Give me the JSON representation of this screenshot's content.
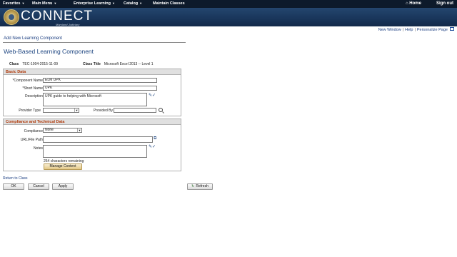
{
  "topnav": {
    "menus": [
      "Favorites",
      "Main Menu",
      "Enterprise Learning",
      "Catalog",
      "Maintain Classes"
    ],
    "home": "Home",
    "signout": "Sign out"
  },
  "banner": {
    "logo": "CONNECT",
    "logo_sub": "Maryland Judiciary"
  },
  "links": {
    "new_window": "New Window",
    "help": "Help",
    "personalize": "Personalize Page"
  },
  "breadcrumb": "Add New Learning Component",
  "page_title": "Web-Based Learning Component",
  "class_info": {
    "class_label": "Class",
    "class_value": "TEC-1004-2015-11-09",
    "title_label": "Class Title",
    "title_value": "Microsoft Excel 2013 -- Level 1"
  },
  "basic": {
    "header": "Basic Data",
    "component_name_label": "*Component Name",
    "component_name": "ELM UPK",
    "short_name_label": "*Short Name",
    "short_name": "UPK",
    "description_label": "Description",
    "description": "UPK guide to helping with Microsoft",
    "provider_type_label": "Provider Type",
    "provider_type": "",
    "provided_by_label": "Provided By",
    "provided_by": ""
  },
  "compliance": {
    "header": "Compliance and Technical Data",
    "compliance_label": "Compliance",
    "compliance_value": "None",
    "url_label": "URL/File Path",
    "url_value": "",
    "notes_label": "Notes",
    "notes_value": "",
    "chars_remaining": "254 characters remaining",
    "manage_content": "Manage Content"
  },
  "return_link": "Return to Class",
  "buttons": {
    "ok": "OK",
    "cancel": "Cancel",
    "apply": "Apply",
    "refresh": "Refresh"
  }
}
